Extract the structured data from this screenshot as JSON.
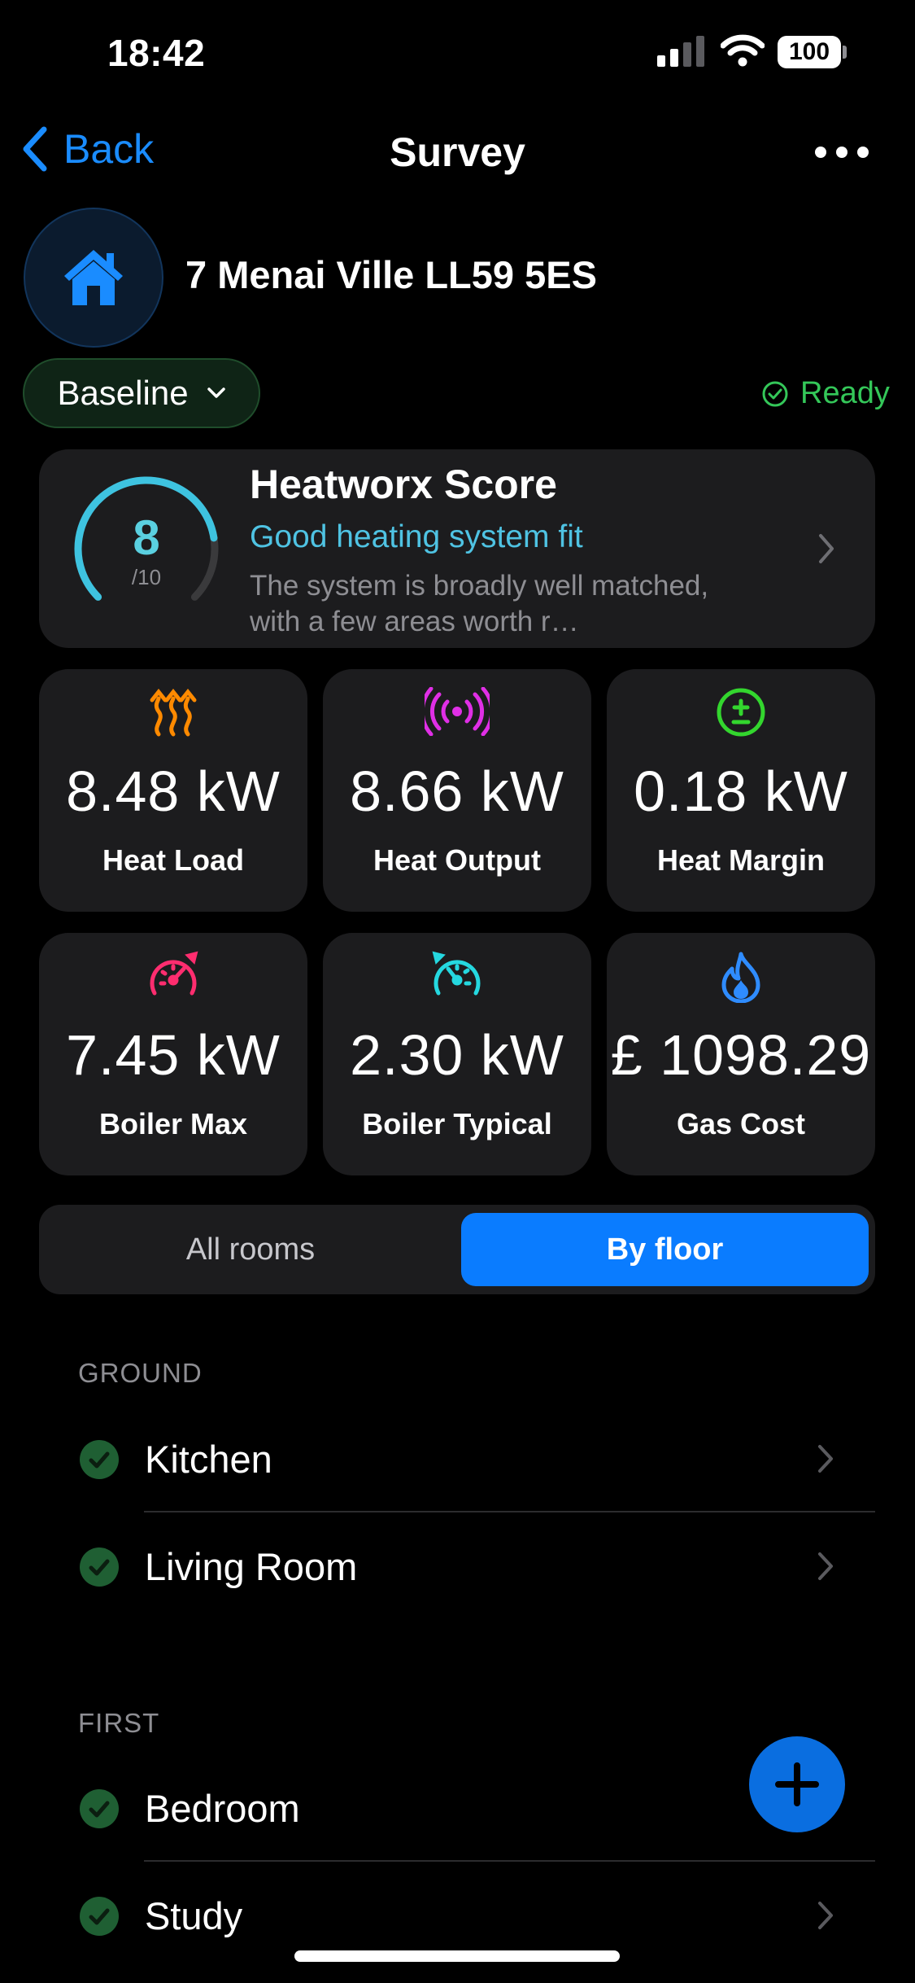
{
  "status_bar": {
    "time": "18:42",
    "battery": "100"
  },
  "nav": {
    "back_label": "Back",
    "title": "Survey"
  },
  "property": {
    "address": "7 Menai Ville LL59 5ES"
  },
  "scenario": {
    "selected": "Baseline",
    "status": "Ready"
  },
  "score": {
    "value": "8",
    "out_of": "/10",
    "fraction": 0.8,
    "title": "Heatworx Score",
    "subtitle": "Good heating system fit",
    "description": "The system is broadly well matched, with a few areas worth r…"
  },
  "metrics": [
    {
      "value": "8.48 kW",
      "label": "Heat Load",
      "icon": "heat-waves-icon",
      "color": "#ff8a00"
    },
    {
      "value": "8.66 kW",
      "label": "Heat Output",
      "icon": "broadcast-icon",
      "color": "#e02fe6"
    },
    {
      "value": "0.18 kW",
      "label": "Heat Margin",
      "icon": "plus-minus-icon",
      "color": "#33d62e"
    },
    {
      "value": "7.45 kW",
      "label": "Boiler Max",
      "icon": "gauge-max-icon",
      "color": "#ff2d6f"
    },
    {
      "value": "2.30 kW",
      "label": "Boiler Typical",
      "icon": "gauge-typical-icon",
      "color": "#25d8e0"
    },
    {
      "value": "£ 1098.29",
      "label": "Gas Cost",
      "icon": "flame-icon",
      "color": "#2f8cff"
    }
  ],
  "view_toggle": {
    "options": [
      "All rooms",
      "By floor"
    ],
    "selected": "By floor"
  },
  "floors": [
    {
      "name": "GROUND",
      "rooms": [
        "Kitchen",
        "Living Room"
      ]
    },
    {
      "name": "FIRST",
      "rooms": [
        "Bedroom",
        "Study"
      ]
    }
  ]
}
